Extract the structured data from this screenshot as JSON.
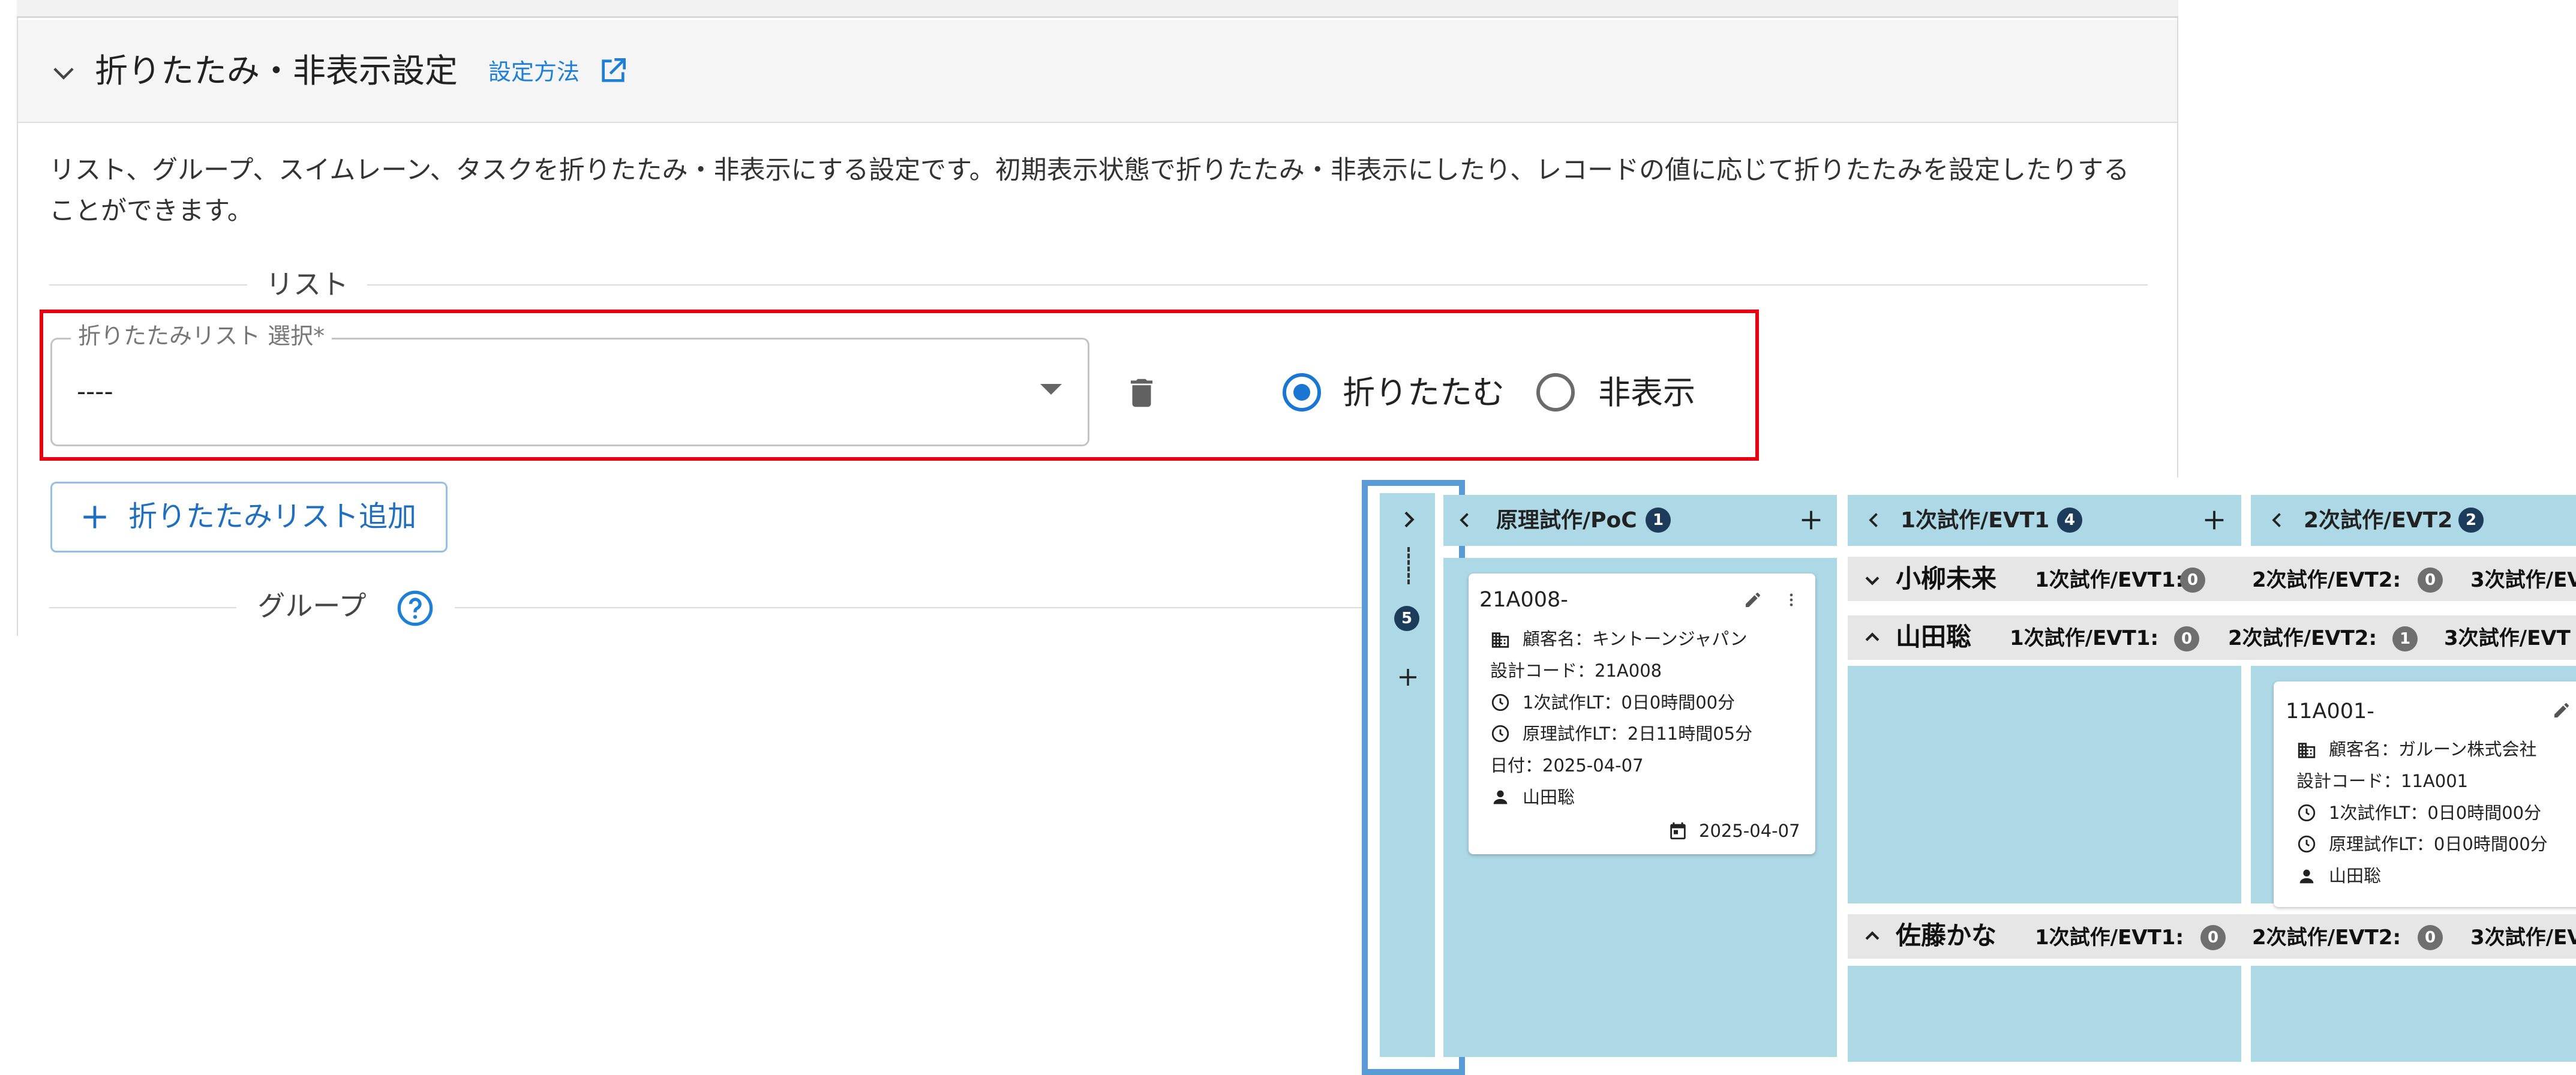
{
  "settings_section": {
    "title": "折りたたみ・非表示設定",
    "howto_link": "設定方法",
    "description": "リスト、グループ、スイムレーン、タスクを折りたたみ・非表示にする設定です。初期表示状態で折りたたみ・非表示にしたり、レコードの値に応じて折りたたみを設定したりすることができます。",
    "list_divider_label": "リスト",
    "collapse_list_select": {
      "label": "折りたたみリスト 選択*",
      "value": "----"
    },
    "radio_options": [
      {
        "label": "折りたたむ",
        "selected": true
      },
      {
        "label": "非表示",
        "selected": false
      }
    ],
    "add_list_button": "折りたたみリスト追加",
    "group_divider_label": "グループ",
    "colors": {
      "accent": "#1976d2",
      "highlight": "#e60012",
      "frame": "#5b9bd5",
      "column_bg": "#add8e6"
    }
  },
  "kanban": {
    "collapsed_column": {
      "badge": "5"
    },
    "columns": [
      {
        "title": "原理試作/PoC",
        "count": "1"
      },
      {
        "title": "1次試作/EVT1",
        "count": "4"
      },
      {
        "title": "2次試作/EVT2",
        "count": "2"
      }
    ],
    "swimlanes": [
      {
        "name": "小柳未来",
        "expanded": false,
        "stats": [
          {
            "label": "1次試作/EVT1:",
            "count": "0"
          },
          {
            "label": "2次試作/EVT2:",
            "count": "0"
          },
          {
            "label": "3次試作/EV",
            "count": ""
          }
        ]
      },
      {
        "name": "山田聡",
        "expanded": true,
        "stats": [
          {
            "label": "1次試作/EVT1:",
            "count": "0"
          },
          {
            "label": "2次試作/EVT2:",
            "count": "1"
          },
          {
            "label": "3次試作/EVT",
            "count": ""
          }
        ]
      },
      {
        "name": "佐藤かな",
        "expanded": true,
        "stats": [
          {
            "label": "1次試作/EVT1:",
            "count": "0"
          },
          {
            "label": "2次試作/EVT2:",
            "count": "0"
          },
          {
            "label": "3次試作/EV",
            "count": ""
          }
        ]
      }
    ],
    "cards": [
      {
        "id": "21A008-",
        "customer": "顧客名：キントーンジャパン",
        "design_code": "設計コード：21A008",
        "lt1": "1次試作LT：0日0時間00分",
        "lt0": "原理試作LT：2日11時間05分",
        "date_line": "日付：2025-04-07",
        "assignee": "山田聡",
        "due": "2025-04-07"
      },
      {
        "id": "11A001-",
        "customer": "顧客名：ガルーン株式会社",
        "design_code": "設計コード：11A001",
        "lt1": "1次試作LT：0日0時間00分",
        "lt0": "原理試作LT：0日0時間00分",
        "assignee": "山田聡"
      }
    ]
  }
}
